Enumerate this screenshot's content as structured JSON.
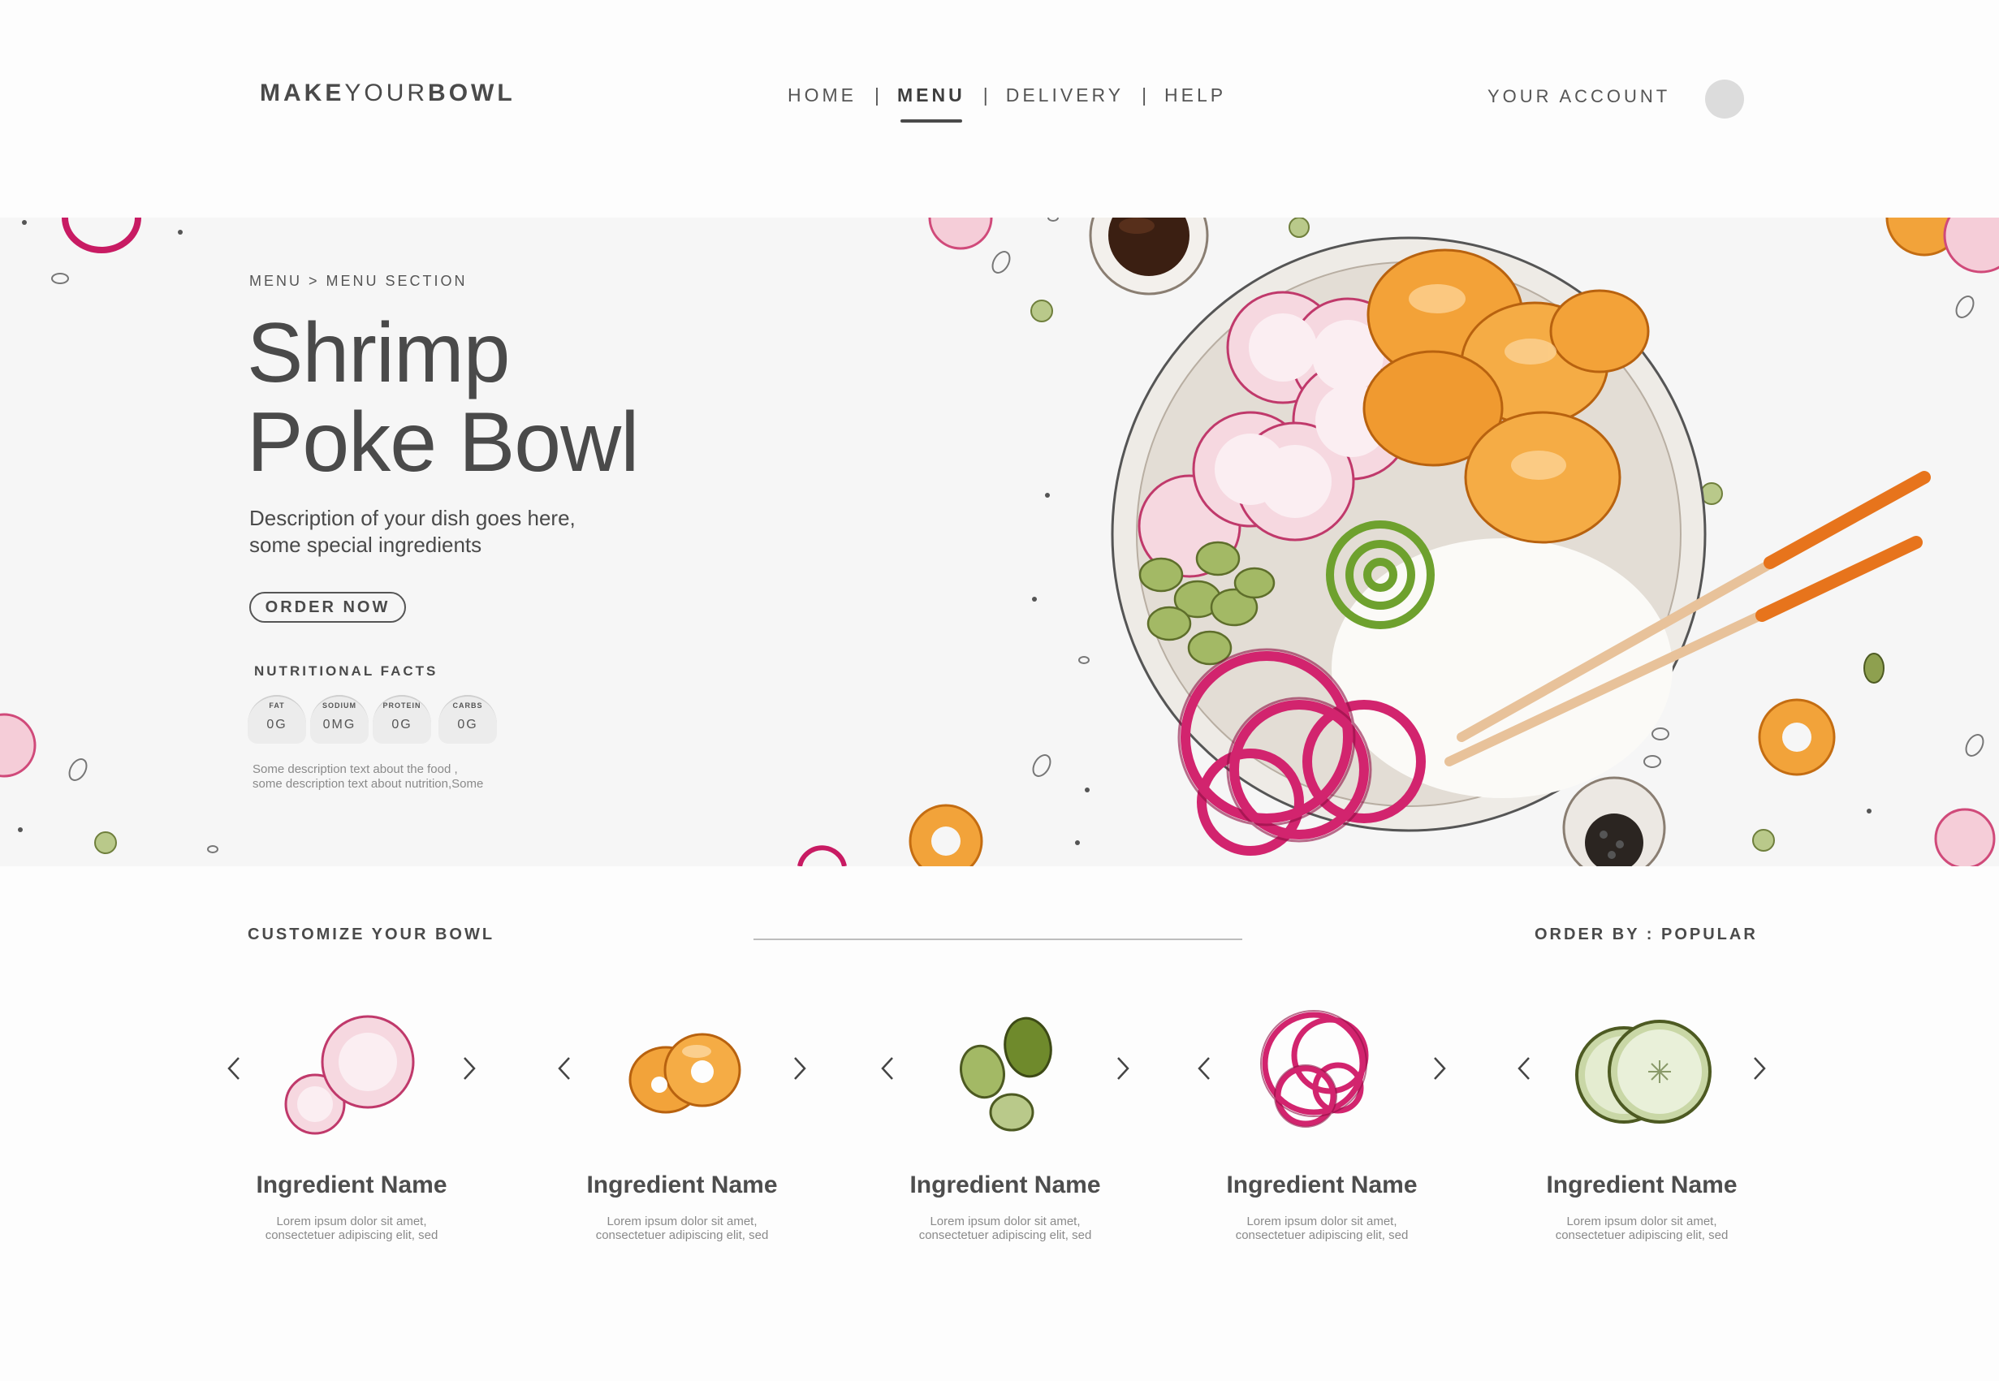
{
  "header": {
    "logo": {
      "part1": "MAKE",
      "part2": "YOUR",
      "part3": "BOWL"
    },
    "nav": [
      {
        "label": "HOME",
        "active": false
      },
      {
        "label": "MENU",
        "active": true
      },
      {
        "label": "DELIVERY",
        "active": false
      },
      {
        "label": "HELP",
        "active": false
      }
    ],
    "nav_separator": "|",
    "account_label": "YOUR ACCOUNT"
  },
  "hero": {
    "breadcrumb": "MENU > MENU SECTION",
    "title_line1": "Shrimp",
    "title_line2": "Poke Bowl",
    "description_line1": "Description of your dish goes here,",
    "description_line2": "some special ingredients",
    "order_button": "ORDER NOW",
    "nutrition_title": "NUTRITIONAL FACTS",
    "nutrition": [
      {
        "label": "FAT",
        "value": "0G"
      },
      {
        "label": "SODIUM",
        "value": "0MG"
      },
      {
        "label": "PROTEIN",
        "value": "0G"
      },
      {
        "label": "CARBS",
        "value": "0G"
      }
    ],
    "note_line1": "Some description text about the food ,",
    "note_line2": "some description text about nutrition,Some"
  },
  "customize": {
    "title": "CUSTOMIZE YOUR BOWL",
    "order_by": "ORDER BY : POPULAR",
    "ingredients": [
      {
        "icon": "radish-icon",
        "name": "Ingredient Name",
        "desc_line1": "Lorem ipsum dolor sit amet,",
        "desc_line2": "consectetuer adipiscing elit, sed"
      },
      {
        "icon": "shrimp-icon",
        "name": "Ingredient Name",
        "desc_line1": "Lorem ipsum dolor sit amet,",
        "desc_line2": "consectetuer adipiscing elit, sed"
      },
      {
        "icon": "edamame-icon",
        "name": "Ingredient Name",
        "desc_line1": "Lorem ipsum dolor sit amet,",
        "desc_line2": "consectetuer adipiscing elit, sed"
      },
      {
        "icon": "pickled-onion-icon",
        "name": "Ingredient Name",
        "desc_line1": "Lorem ipsum dolor sit amet,",
        "desc_line2": "consectetuer adipiscing elit, sed"
      },
      {
        "icon": "cucumber-icon",
        "name": "Ingredient Name",
        "desc_line1": "Lorem ipsum dolor sit amet,",
        "desc_line2": "consectetuer adipiscing elit, sed"
      }
    ]
  },
  "colors": {
    "text": "#4a4a4a",
    "hero_bg": "#f6f6f6",
    "radish": "#f2c6d2",
    "onion": "#d2246e",
    "shrimp": "#f2a33a",
    "edamame": "#9bb35a",
    "cucumber": "#c9d7a6"
  }
}
